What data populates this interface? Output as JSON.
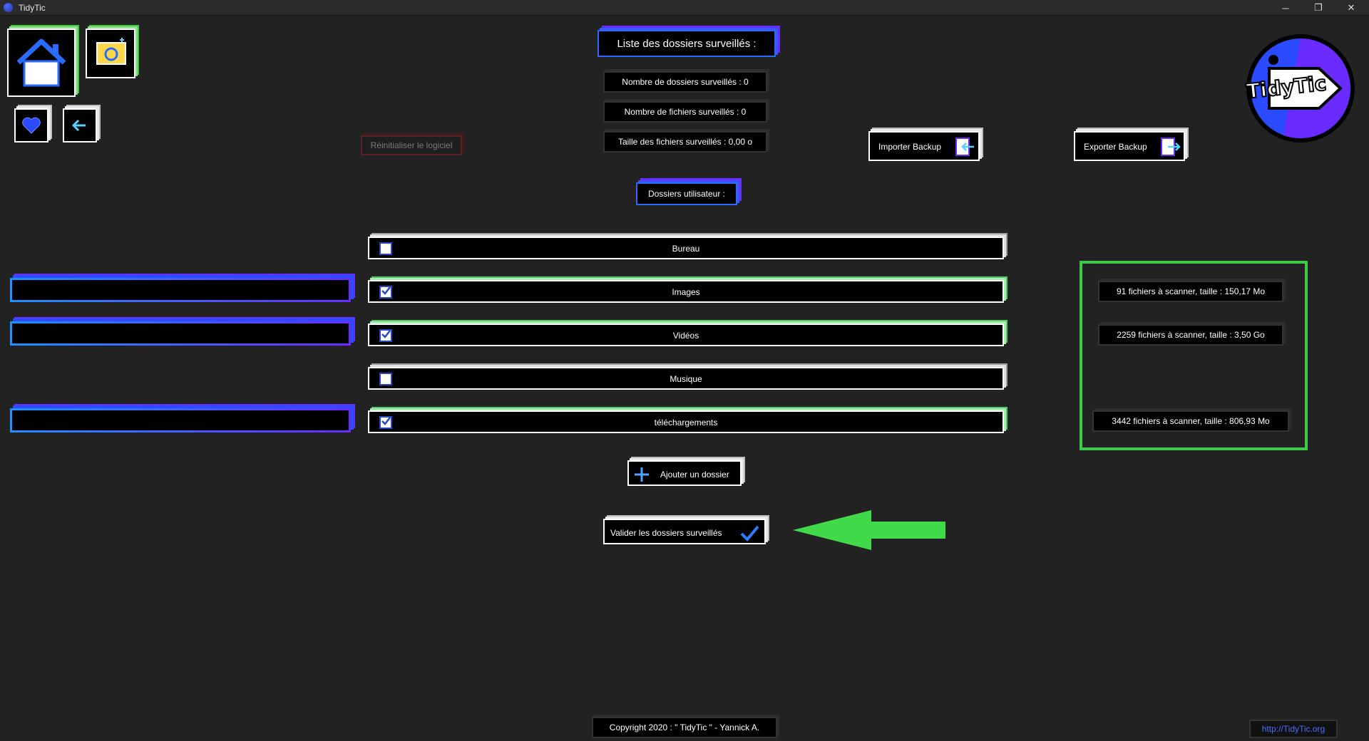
{
  "window": {
    "title": "TidyTic",
    "controls": [
      "─",
      "❐",
      "✕"
    ]
  },
  "header": {
    "title": "Liste des dossiers surveillés :"
  },
  "stats": {
    "folder_count": "Nombre de dossiers surveillés : 0",
    "file_count": "Nombre de fichiers surveillés : 0",
    "file_size": "Taille des fichiers surveillés : 0,00 o"
  },
  "buttons": {
    "reset": "Réinitialiser le logiciel",
    "import_backup": "Importer Backup",
    "export_backup": "Exporter Backup",
    "add_folder": "Ajouter un dossier",
    "validate": "Valider les dossiers surveillés"
  },
  "user_folders": {
    "title": "Dossiers utilisateur :",
    "items": [
      {
        "label": "Bureau",
        "checked": false
      },
      {
        "label": "Images",
        "checked": true
      },
      {
        "label": "Vidéos",
        "checked": true
      },
      {
        "label": "Musique",
        "checked": false
      },
      {
        "label": "téléchargements",
        "checked": true
      }
    ]
  },
  "scan_info": {
    "images": "91 fichiers à scanner, taille : 150,17 Mo",
    "videos": "2259 fichiers à scanner, taille : 3,50 Go",
    "downloads": "3442 fichiers à scanner, taille : 806,93 Mo"
  },
  "logo": {
    "text": "TidyTic"
  },
  "footer": {
    "copyright": "Copyright 2020 : \" TidyTic \" - Yannick A.",
    "link": "http://TidyTic.org"
  },
  "colors": {
    "accent_blue": "#1f6bff",
    "accent_purple": "#6a2bff",
    "accent_green": "#3ec94a",
    "background": "#222222"
  },
  "icons": [
    "home-icon",
    "folder-refresh-icon",
    "heart-icon",
    "back-arrow-icon",
    "import-icon",
    "export-icon",
    "plus-icon",
    "check-icon",
    "checkbox-icon"
  ]
}
